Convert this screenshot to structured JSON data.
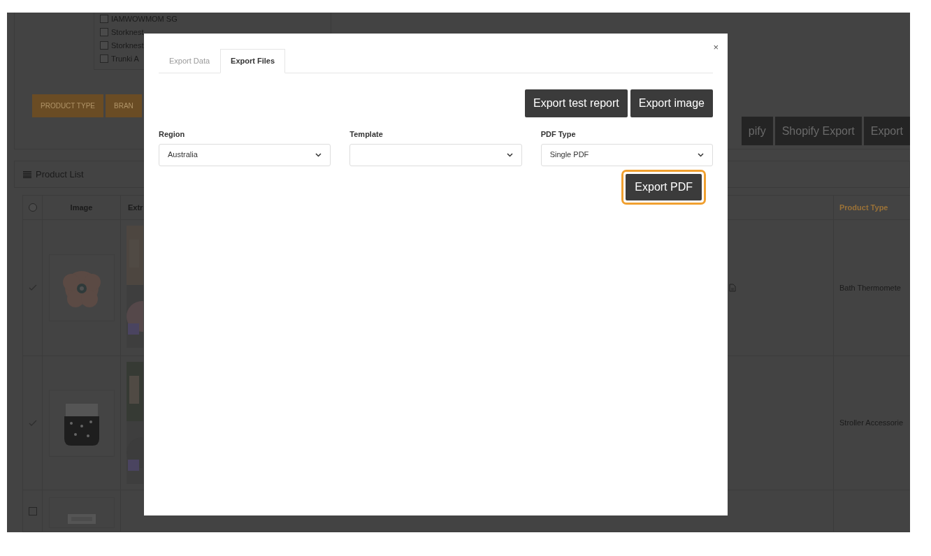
{
  "background": {
    "store_checklist": [
      {
        "label": "IAMWOWMOM SG",
        "checked": false
      },
      {
        "label": "Storknest",
        "checked": false
      },
      {
        "label": "Storknest",
        "checked": false
      },
      {
        "label": "Trunki A",
        "checked": false
      }
    ],
    "filter_buttons": [
      "PRODUCT TYPE",
      "BRAN"
    ],
    "export_buttons": [
      "pify",
      "Shopify Export",
      "Export"
    ],
    "panel_title": "Product List",
    "table": {
      "select_all": {
        "checked": false
      },
      "columns": [
        "Image",
        "Extr",
        "Product Type"
      ],
      "rows": [
        {
          "checked": true,
          "has_file": true,
          "product_type": "Bath Thermomete"
        },
        {
          "checked": true,
          "has_file": false,
          "product_type": "Stroller Accessorie"
        },
        {
          "checked": false,
          "has_file": false
        }
      ]
    }
  },
  "dialog": {
    "close": "×",
    "tabs": [
      {
        "label": "Export Data",
        "selected": false
      },
      {
        "label": "Export Files",
        "selected": true
      }
    ],
    "actions": [
      "Export test report",
      "Export image"
    ],
    "fields": [
      {
        "label": "Region",
        "value": "Australia"
      },
      {
        "label": "Template"
      },
      {
        "label": "PDF Type",
        "value": "Single PDF"
      }
    ],
    "primary_button": {
      "label": "Export PDF",
      "focused": true
    }
  }
}
